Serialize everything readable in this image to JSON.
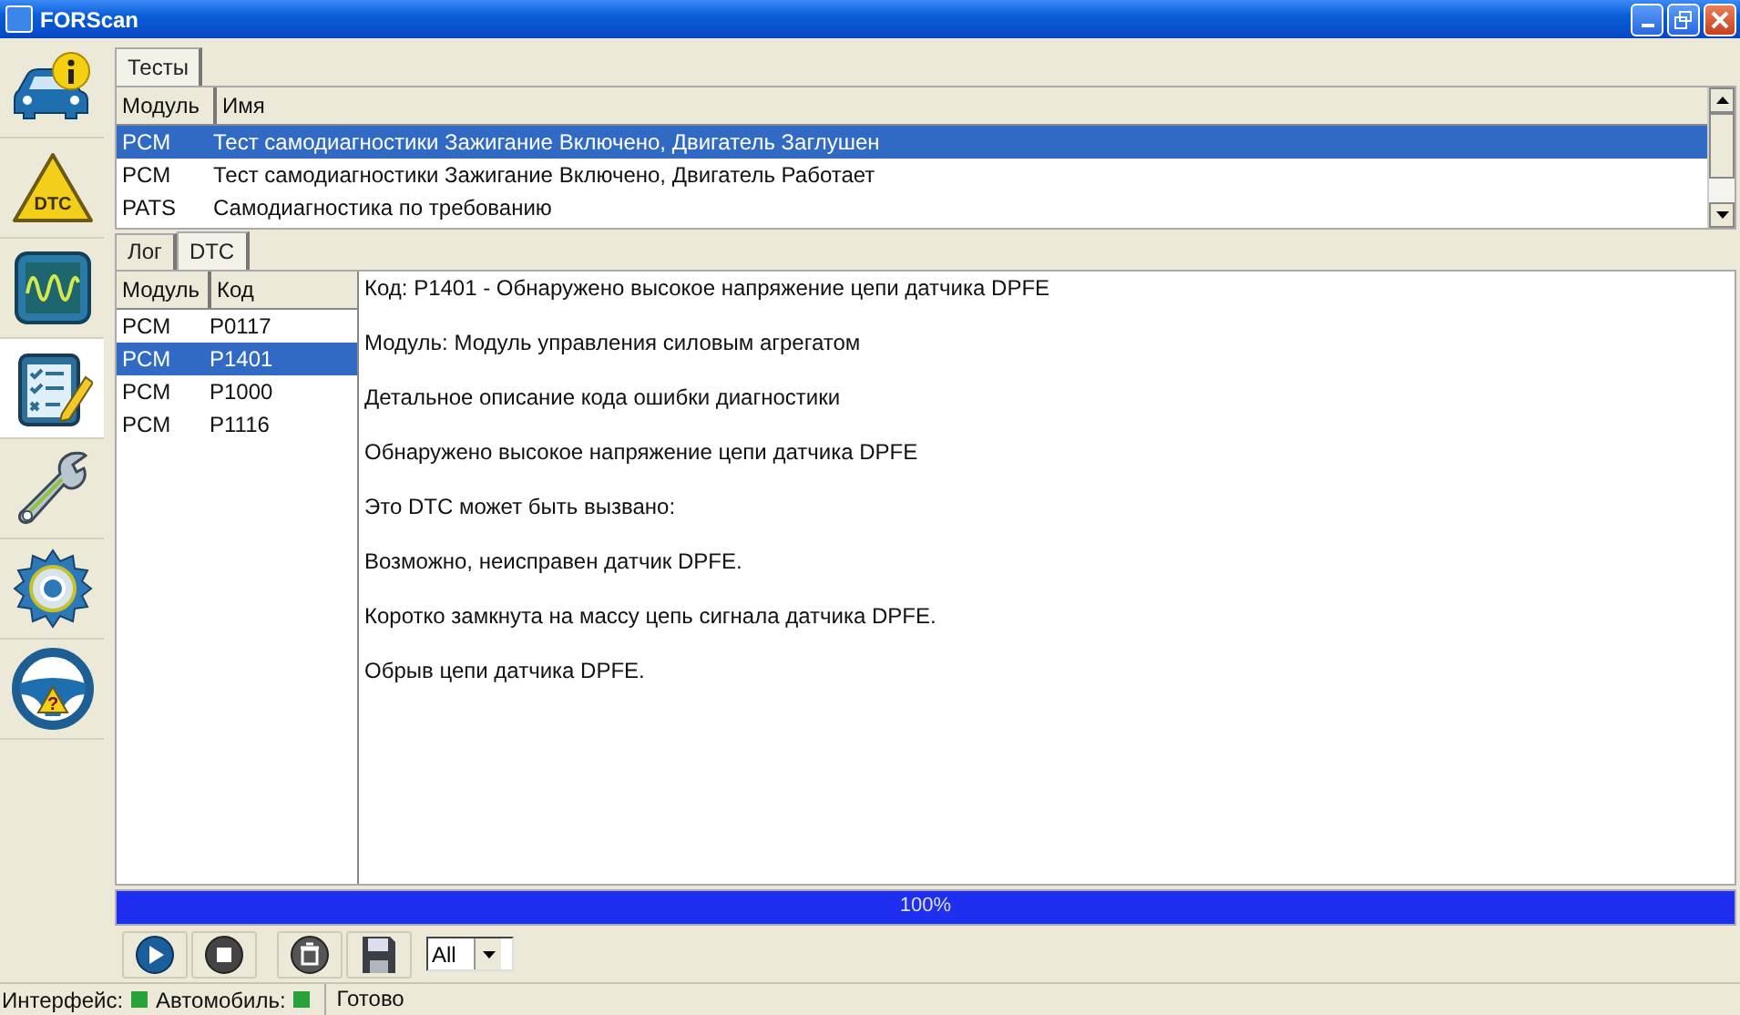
{
  "window": {
    "title": "FORScan"
  },
  "sidebar": {
    "items": [
      {
        "kind": "car-info",
        "selected": false
      },
      {
        "kind": "dtc",
        "label": "DTC",
        "selected": false
      },
      {
        "kind": "scope",
        "selected": false
      },
      {
        "kind": "checklist",
        "selected": true
      },
      {
        "kind": "wrench",
        "selected": false
      },
      {
        "kind": "gear",
        "selected": false
      },
      {
        "kind": "help",
        "label": "?",
        "selected": false
      }
    ]
  },
  "tests_tabs": [
    {
      "label": "Тесты",
      "selected": true
    }
  ],
  "tests_table": {
    "columns": [
      "Модуль",
      "Имя"
    ],
    "rows": [
      {
        "module": "PCM",
        "name": "Тест самодиагностики Зажигание Включено, Двигатель Заглушен",
        "selected": true
      },
      {
        "module": "PCM",
        "name": "Тест самодиагностики Зажигание Включено, Двигатель Работает",
        "selected": false
      },
      {
        "module": "PATS",
        "name": "Самодиагностика по требованию",
        "selected": false
      }
    ]
  },
  "log_tabs": [
    {
      "label": "Лог",
      "selected": false
    },
    {
      "label": "DTC",
      "selected": true
    }
  ],
  "dtc_table": {
    "columns": [
      "Модуль",
      "Код"
    ],
    "rows": [
      {
        "module": "PCM",
        "code": "P0117",
        "selected": false
      },
      {
        "module": "PCM",
        "code": "P1401",
        "selected": true
      },
      {
        "module": "PCM",
        "code": "P1000",
        "selected": false
      },
      {
        "module": "PCM",
        "code": "P1116",
        "selected": false
      }
    ]
  },
  "dtc_details": [
    "Код: P1401 - Обнаружено высокое напряжение цепи датчика DPFE",
    "Модуль: Модуль управления силовым агрегатом",
    "Детальное описание кода ошибки диагностики",
    "Обнаружено высокое напряжение цепи датчика DPFE",
    "Это DTC может быть вызвано:",
    "Возможно, неисправен датчик DPFE.",
    "Коротко замкнута на массу цепь сигнала датчика DPFE.",
    "Обрыв цепи датчика DPFE."
  ],
  "progress": {
    "level": 1,
    "reading": "100%"
  },
  "toolbar": {
    "buttons": [
      {
        "kind": "play"
      },
      {
        "kind": "stop"
      },
      {
        "kind": "clear"
      },
      {
        "kind": "save"
      }
    ],
    "filter": {
      "value": "All"
    }
  },
  "status_bar": {
    "indicators": [
      {
        "label": "Интерфейс:",
        "connected": true
      },
      {
        "label": "Автомобиль:",
        "connected": true
      }
    ],
    "message": "Готово"
  }
}
